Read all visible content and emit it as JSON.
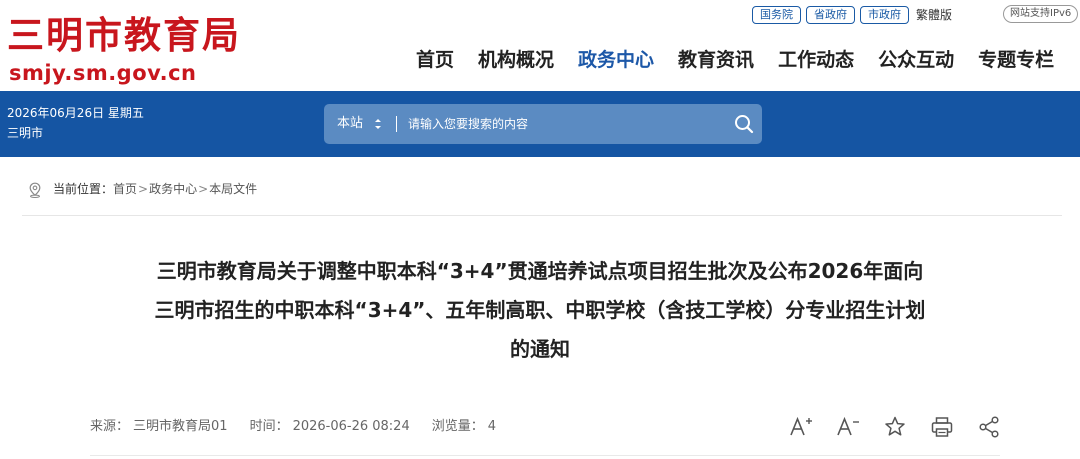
{
  "brand": {
    "name_cn": "三明市教育局",
    "domain": "smjy.sm.gov.cn",
    "color": "#c8161d"
  },
  "toplinks": [
    "国务院",
    "省政府",
    "市政府"
  ],
  "toplink_plain": "繁體版",
  "ipv6_badge": "网站支持IPv6",
  "nav": {
    "items": [
      {
        "label": "首页",
        "active": false
      },
      {
        "label": "机构概况",
        "active": false
      },
      {
        "label": "政务中心",
        "active": true
      },
      {
        "label": "教育资讯",
        "active": false
      },
      {
        "label": "工作动态",
        "active": false
      },
      {
        "label": "公众互动",
        "active": false
      },
      {
        "label": "专题专栏",
        "active": false
      }
    ],
    "active_color": "#1d58a8"
  },
  "band": {
    "date": "2026年06月26日 星期五",
    "city": "三明市",
    "color": "#1555a3"
  },
  "search": {
    "scope": "本站",
    "placeholder": "请输入您要搜索的内容",
    "icon": "search-icon"
  },
  "breadcrumb": {
    "label": "当前位置：",
    "items": [
      "首页",
      "政务中心",
      "本局文件"
    ],
    "separator": ">"
  },
  "article": {
    "title_lines": [
      "三明市教育局关于调整中职本科“3+4”贯通培养试点项目招生批次及公布2026年面向",
      "三明市招生的中职本科“3+4”、五年制高职、中职学校（含技工学校）分专业招生计划",
      "的通知"
    ],
    "meta": {
      "source_label": "来源：",
      "source": "三明市教育局01",
      "time_label": "时间：",
      "time": "2026-06-26 08:24",
      "views_label": "浏览量：",
      "views": "4"
    },
    "tools": [
      "font-increase-icon",
      "font-decrease-icon",
      "star-icon",
      "print-icon",
      "share-icon"
    ]
  }
}
